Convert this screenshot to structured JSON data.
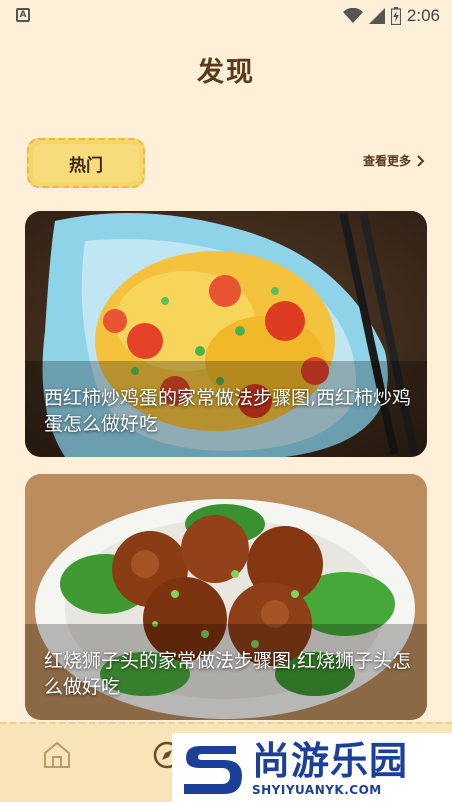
{
  "status_bar": {
    "left_icon": "A",
    "time": "2:06",
    "icons": [
      "wifi-icon",
      "signal-icon",
      "battery-icon"
    ]
  },
  "page": {
    "title": "发现"
  },
  "section": {
    "hot_label": "热门",
    "more_label": "查看更多"
  },
  "cards": [
    {
      "title": "西红柿炒鸡蛋的家常做法步骤图,西红柿炒鸡蛋怎么做好吃"
    },
    {
      "title": "红烧狮子头的家常做法步骤图,红烧狮子头怎么做好吃"
    }
  ],
  "bottom_nav": {
    "items": [
      "home-icon",
      "discover-icon"
    ]
  },
  "watermark": {
    "main": "尚游乐园",
    "sub": "SHYIYUANYK.COM"
  },
  "colors": {
    "background": "#fdefd8",
    "badge": "#f6d56b",
    "title": "#5a3a1a",
    "watermark": "#1c3f9a"
  }
}
